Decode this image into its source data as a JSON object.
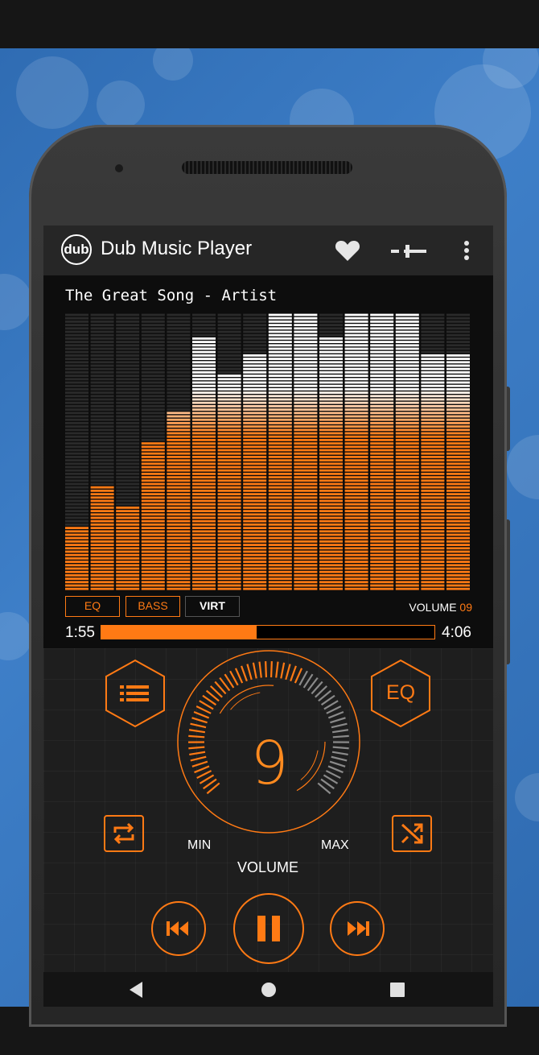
{
  "app": {
    "logo_text": "dub",
    "title": "Dub Music Player",
    "icons": [
      "heart-icon",
      "equalizer-slider-icon",
      "more-vert-icon"
    ]
  },
  "visualizer": {
    "song_title": "The Great Song - Artist",
    "bar_levels": [
      0.23,
      0.38,
      0.31,
      0.54,
      0.65,
      0.91,
      0.78,
      0.85,
      1.0,
      1.0,
      0.91,
      1.0,
      1.0,
      1.0,
      0.85,
      0.85
    ],
    "colors": {
      "accent": "#ff7a14",
      "peak": "#ffffff"
    }
  },
  "effects": {
    "eq_label": "EQ",
    "bass_label": "BASS",
    "virt_label": "VIRT",
    "volume_label": "VOLUME",
    "volume_value": "09"
  },
  "playback": {
    "elapsed": "1:55",
    "total": "4:06",
    "progress": 0.467
  },
  "controls": {
    "knob_value": "9",
    "knob_fraction": 0.6,
    "min_label": "MIN",
    "max_label": "MAX",
    "volume_caption": "VOLUME",
    "eq_button_label": "EQ",
    "icons": [
      "playlist-icon",
      "repeat-icon",
      "shuffle-icon",
      "previous-icon",
      "pause-icon",
      "next-icon"
    ]
  },
  "nav": {
    "icons": [
      "back-icon",
      "home-icon",
      "recents-icon"
    ]
  }
}
